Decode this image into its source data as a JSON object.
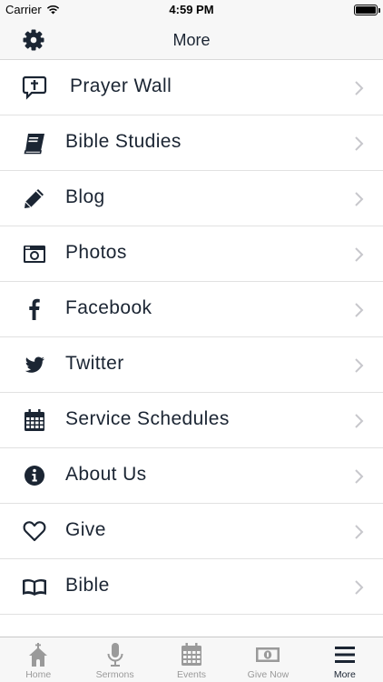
{
  "status_bar": {
    "carrier": "Carrier",
    "time": "4:59 PM"
  },
  "nav": {
    "title": "More",
    "settings_icon": "gear-icon"
  },
  "menu": {
    "items": [
      {
        "label": "Prayer Wall",
        "icon": "prayer-bubble-icon"
      },
      {
        "label": "Bible Studies",
        "icon": "book-icon"
      },
      {
        "label": "Blog",
        "icon": "pencil-icon"
      },
      {
        "label": "Photos",
        "icon": "camera-icon"
      },
      {
        "label": "Facebook",
        "icon": "facebook-icon"
      },
      {
        "label": "Twitter",
        "icon": "twitter-icon"
      },
      {
        "label": "Service Schedules",
        "icon": "calendar-icon"
      },
      {
        "label": "About Us",
        "icon": "info-icon"
      },
      {
        "label": "Give",
        "icon": "heart-icon"
      },
      {
        "label": "Bible",
        "icon": "open-book-icon"
      }
    ]
  },
  "tab_bar": {
    "tabs": [
      {
        "label": "Home",
        "icon": "church-icon",
        "active": false
      },
      {
        "label": "Sermons",
        "icon": "microphone-icon",
        "active": false
      },
      {
        "label": "Events",
        "icon": "calendar-icon",
        "active": false
      },
      {
        "label": "Give Now",
        "icon": "money-icon",
        "active": false
      },
      {
        "label": "More",
        "icon": "hamburger-icon",
        "active": true
      }
    ]
  },
  "colors": {
    "text": "#1b2533",
    "inactive_tab": "#9a9a9a",
    "bar_bg": "#f7f7f7",
    "chevron": "#c7c7cc"
  }
}
